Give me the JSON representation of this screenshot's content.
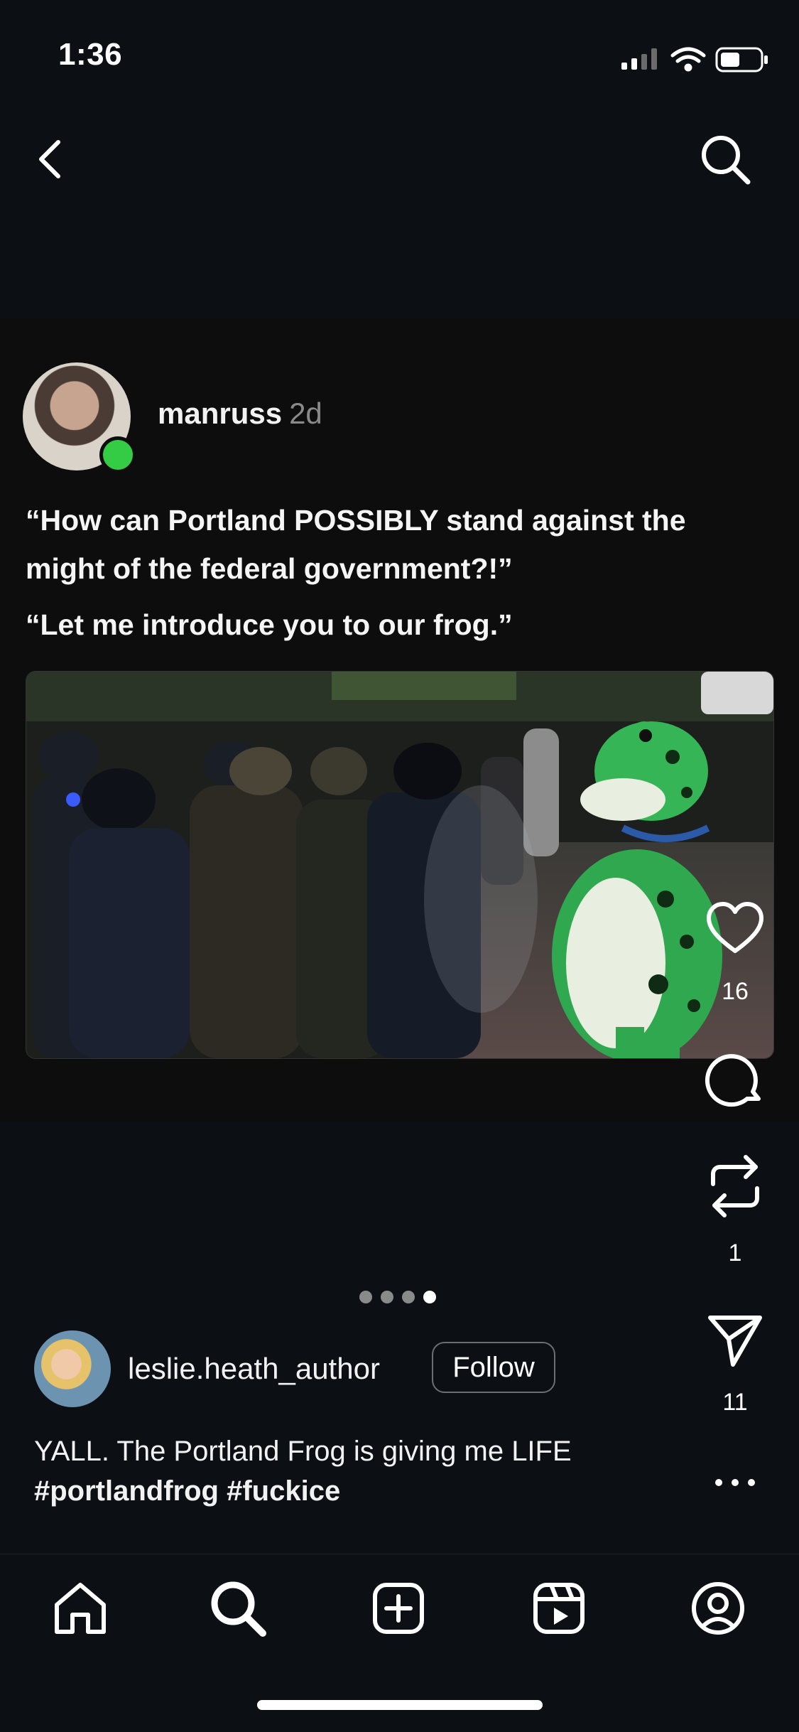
{
  "status_bar": {
    "time": "1:36"
  },
  "post": {
    "username": "manruss",
    "age": "2d",
    "text_line_1": "“How can Portland POSSIBLY stand against the might of the federal government?!”",
    "text_line_2": "“Let me introduce you to our frog.”",
    "image_alt": "Riot police lined up facing a person in an inflatable green frog costume at night"
  },
  "actions": {
    "likes": "16",
    "reposts": "1",
    "shares": "11"
  },
  "carousel": {
    "total": 4,
    "active_index": 3
  },
  "author": {
    "name": "leslie.heath_author",
    "follow_label": "Follow",
    "caption_text": "YALL. The Portland Frog is giving me LIFE",
    "caption_tags": "#portlandfrog #fuckice"
  },
  "icons": {
    "back": "chevron-left-icon",
    "search": "search-icon",
    "like": "heart-icon",
    "comment": "comment-icon",
    "repost": "repost-icon",
    "share": "send-icon",
    "more": "more-horizontal-icon",
    "home": "home-icon",
    "create": "plus-square-icon",
    "reels": "reels-icon",
    "profile": "profile-icon"
  },
  "colors": {
    "background": "#0c1015",
    "card": "#0d0d0e",
    "online": "#33cc44",
    "frog_green": "#2fa84f"
  }
}
